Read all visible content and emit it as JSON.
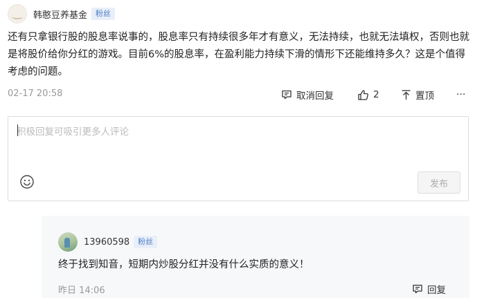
{
  "comment": {
    "username": "韩憨豆养基金",
    "badge": "粉丝",
    "body": "还有只拿银行股的股息率说事的，股息率只有持续很多年才有意义，无法持续，也就无法填权，否则也就是将股价给你分红的游戏。目前6%的股息率，在盈利能力持续下滑的情形下还能维持多久？这是个值得考虑的问题。",
    "time": "02-17 20:58",
    "actions": {
      "cancel_reply": "取消回复",
      "like_count": "2",
      "pin": "置顶",
      "more": "···"
    }
  },
  "reply_box": {
    "placeholder": "积极回复可吸引更多人评论",
    "publish_label": "发布"
  },
  "sub_reply": {
    "username": "13960598",
    "badge": "粉丝",
    "body": "终于找到知音，短期内炒股分红并没有什么实质的意义！",
    "time": "昨日 14:06",
    "reply_label": "回复"
  },
  "icons": {
    "reply": "comment-bubble-icon",
    "like": "thumbs-up-icon",
    "pin": "pin-top-icon",
    "more": "more-dots-icon",
    "emoji": "smiley-icon"
  }
}
